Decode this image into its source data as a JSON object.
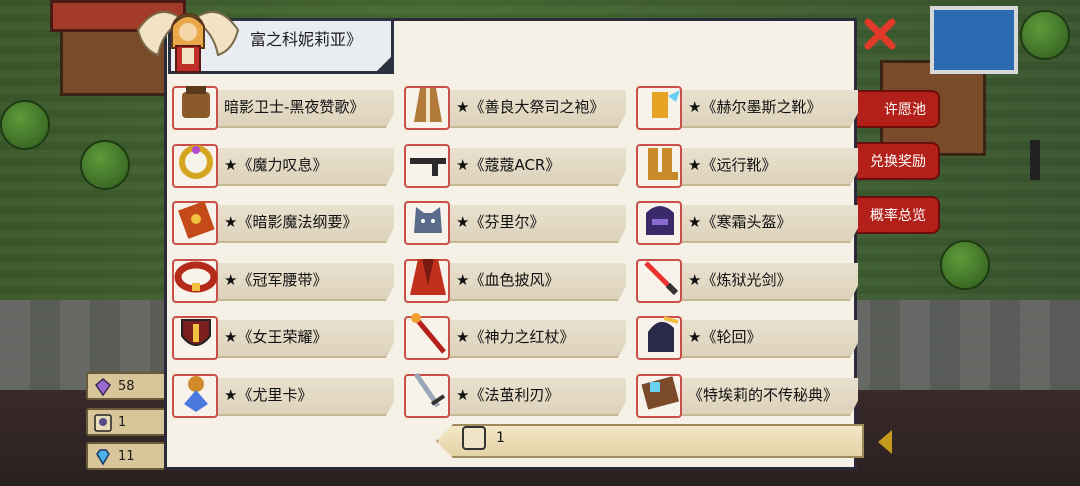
{
  "title": "富之科妮莉亚》",
  "close_icon": "close-icon",
  "side_menu": [
    "许愿池",
    "兑换奖励",
    "概率总览"
  ],
  "resources": [
    {
      "icon": "crystal-icon",
      "value": "58"
    },
    {
      "icon": "ticket-icon",
      "value": "1"
    },
    {
      "icon": "diamond-icon",
      "value": "11"
    }
  ],
  "items": [
    {
      "label": "暗影卫士-黑夜赞歌》",
      "icon": "armor-icon",
      "color": "#8a5a2b"
    },
    {
      "label": "★《善良大祭司之袍》",
      "icon": "robe-icon",
      "color": "#b07a3a"
    },
    {
      "label": "★《赫尔墨斯之靴》",
      "icon": "winged-boots-icon",
      "color": "#e7a324"
    },
    {
      "label": "★《魔力叹息》",
      "icon": "ring-icon",
      "color": "#d4a61f"
    },
    {
      "label": "★《蔻蔻ACR》",
      "icon": "rifle-icon",
      "color": "#2a2a2a"
    },
    {
      "label": "★《远行靴》",
      "icon": "boots-icon",
      "color": "#c98a2a"
    },
    {
      "label": "★《暗影魔法纲要》",
      "icon": "spellbook-icon",
      "color": "#c44a1a"
    },
    {
      "label": "★《芬里尔》",
      "icon": "wolf-icon",
      "color": "#5a6a8a"
    },
    {
      "label": "★《寒霜头盔》",
      "icon": "helmet-icon",
      "color": "#3a2a6a"
    },
    {
      "label": "★《冠军腰带》",
      "icon": "belt-icon",
      "color": "#b32a1a"
    },
    {
      "label": "★《血色披风》",
      "icon": "cloak-icon",
      "color": "#c0301c"
    },
    {
      "label": "★《炼狱光剑》",
      "icon": "lightsaber-icon",
      "color": "#e33"
    },
    {
      "label": "★《女王荣耀》",
      "icon": "shield-icon",
      "color": "#7a1e1e"
    },
    {
      "label": "★《神力之红杖》",
      "icon": "staff-icon",
      "color": "#b6201a"
    },
    {
      "label": "★《轮回》",
      "icon": "gauntlet-icon",
      "color": "#2a2a4a"
    },
    {
      "label": "★《尤里卡》",
      "icon": "amulet-icon",
      "color": "#d08a2a"
    },
    {
      "label": "★《法茧利刃》",
      "icon": "sword-icon",
      "color": "#cfd7e0"
    },
    {
      "label": "《特埃莉的不传秘典》",
      "icon": "tome-icon",
      "color": "#7a4a2a"
    }
  ],
  "counter": {
    "icon": "ticket-icon",
    "value": "1"
  }
}
